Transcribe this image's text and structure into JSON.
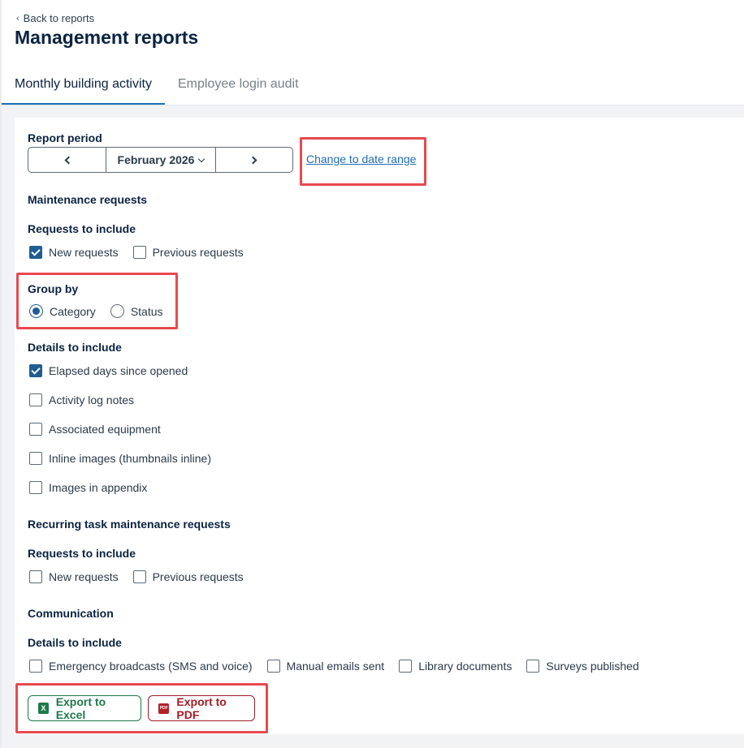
{
  "header": {
    "back_label": "Back to reports",
    "title": "Management reports"
  },
  "tabs": [
    {
      "label": "Monthly building activity",
      "active": true
    },
    {
      "label": "Employee login audit",
      "active": false
    }
  ],
  "report_period": {
    "label": "Report period",
    "value": "February 2026",
    "date_range_link": "Change to date range"
  },
  "maintenance": {
    "heading": "Maintenance requests",
    "requests_label": "Requests to include",
    "requests": [
      {
        "label": "New requests",
        "checked": true
      },
      {
        "label": "Previous requests",
        "checked": false
      }
    ],
    "group_label": "Group by",
    "group_options": [
      {
        "label": "Category",
        "selected": true
      },
      {
        "label": "Status",
        "selected": false
      }
    ],
    "details_label": "Details to include",
    "details": [
      {
        "label": "Elapsed days since opened",
        "checked": true
      },
      {
        "label": "Activity log notes",
        "checked": false
      },
      {
        "label": "Associated equipment",
        "checked": false
      },
      {
        "label": "Inline images (thumbnails inline)",
        "checked": false
      },
      {
        "label": "Images in appendix",
        "checked": false
      }
    ]
  },
  "recurring": {
    "heading": "Recurring task maintenance requests",
    "requests_label": "Requests to include",
    "requests": [
      {
        "label": "New requests",
        "checked": false
      },
      {
        "label": "Previous requests",
        "checked": false
      }
    ]
  },
  "communication": {
    "heading": "Communication",
    "details_label": "Details to include",
    "details": [
      {
        "label": "Emergency broadcasts (SMS and voice)",
        "checked": false
      },
      {
        "label": "Manual emails sent",
        "checked": false
      },
      {
        "label": "Library documents",
        "checked": false
      },
      {
        "label": "Surveys published",
        "checked": false
      }
    ]
  },
  "export": {
    "excel_label": "Export to Excel",
    "excel_icon": "X",
    "pdf_label": "Export to PDF",
    "pdf_icon": "PDF"
  },
  "colors": {
    "accent": "#1f5d93",
    "link": "#1f6fb3",
    "excel": "#1e7a4c",
    "pdf": "#a21c26",
    "highlight": "#e8494f"
  }
}
